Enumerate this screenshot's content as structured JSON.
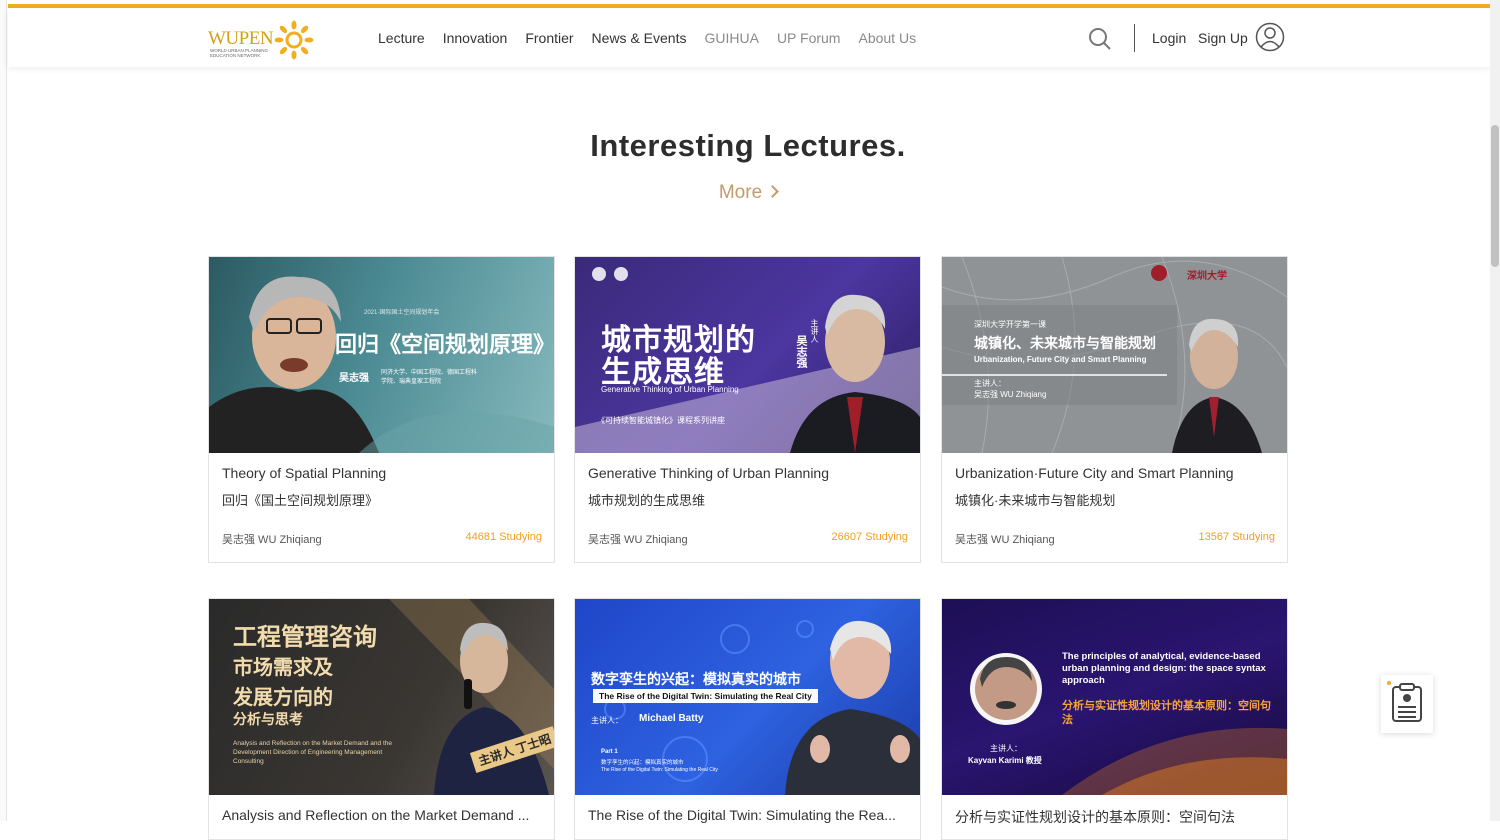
{
  "header": {
    "logo": {
      "word": "WUPEN",
      "sub": "WORLD URBAN PLANNING EDUCATION NETWORK"
    },
    "nav": [
      "Lecture",
      "Innovation",
      "Frontier",
      "News & Events",
      "GUIHUA",
      "UP Forum",
      "About Us"
    ],
    "login": "Login",
    "signup": "Sign Up"
  },
  "section": {
    "title": "Interesting Lectures.",
    "more": "More"
  },
  "cards": [
    {
      "title": "Theory of Spatial Planning",
      "subtitle": "回归《国土空间规划原理》",
      "author": "吴志强 WU Zhiqiang",
      "count": "44681 Studying",
      "thumb": {
        "headline": "回归《空间规划原理》",
        "topline": "2021·国际国土空间规划年会",
        "name": "吴志强",
        "note": "同济大学、中国工程院、德国工程科学院、瑞典皇家工程院"
      }
    },
    {
      "title": "Generative Thinking of Urban Planning",
      "subtitle": "城市规划的生成思维",
      "author": "吴志强 WU Zhiqiang",
      "count": "26607 Studying",
      "thumb": {
        "headline1": "城市规划的",
        "headline2": "生成思维",
        "en": "Generative Thinking of Urban Planning",
        "series": "《可持续智能城镇化》课程系列讲座",
        "speaker": "主讲人",
        "name": "吴志强"
      }
    },
    {
      "title": "Urbanization·Future City and Smart Planning",
      "subtitle": "城镇化·未来城市与智能规划",
      "author": "吴志强 WU Zhiqiang",
      "count": "13567 Studying",
      "thumb": {
        "kicker": "深圳大学开学第一课",
        "headline": "城镇化、未来城市与智能规划",
        "en": "Urbanization, Future City and Smart Planning",
        "speaker": "主讲人：",
        "name": "吴志强 WU Zhiqiang",
        "univ": "深圳大学"
      }
    },
    {
      "title": "Analysis and Reflection on the Market Demand ...",
      "subtitle": "",
      "author": "",
      "count": "",
      "thumb": {
        "l1": "工程管理咨询",
        "l2": "市场需求及",
        "l3": "发展方向的",
        "l4": "分析与思考",
        "en": "Analysis and Reflection on the Market Demand and the Development Direction of Engineering Management Consulting",
        "name": "主讲人 丁士昭"
      }
    },
    {
      "title": "The Rise of the Digital Twin: Simulating the Rea...",
      "subtitle": "",
      "author": "",
      "count": "",
      "thumb": {
        "headline": "数字孪生的兴起：模拟真实的城市",
        "en": "The Rise of the Digital Twin: Simulating the Real City",
        "speaker": "主讲人：",
        "name": "Michael Batty",
        "part": "Part 1",
        "partcn": "数字孪生的兴起：模拟真实的城市",
        "parten": "The Rise of the Digital Twin: Simulating the Real City"
      }
    },
    {
      "title": "分析与实证性规划设计的基本原则：空间句法",
      "subtitle": "",
      "author": "",
      "count": "",
      "thumb": {
        "en": "The principles of analytical, evidence-based urban planning and design: the space syntax approach",
        "cn": "分析与实证性规划设计的基本原则：空间句法",
        "speaker": "主讲人：",
        "name": "Kayvan Karimi 教授"
      }
    }
  ]
}
